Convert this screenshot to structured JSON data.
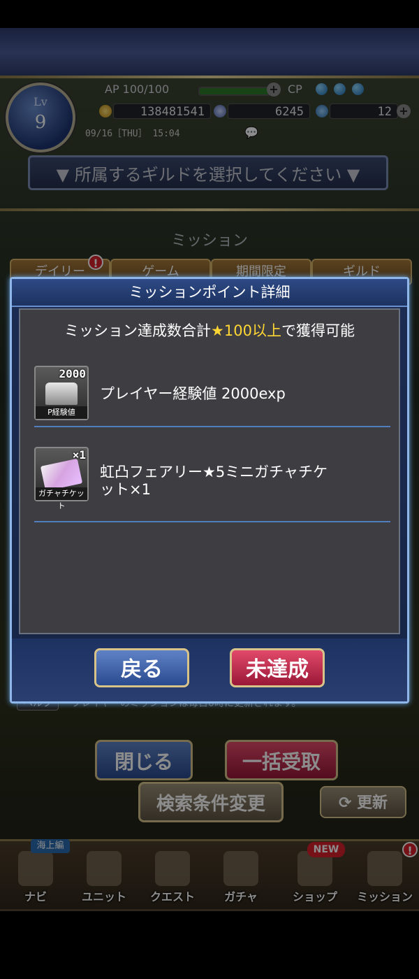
{
  "header": {
    "level_label": "Lv",
    "level_value": "9",
    "ap_text": "AP 100/100",
    "cp_label": "CP",
    "gold": "138481541",
    "gems": "6245",
    "tickets": "12",
    "datetime": "09/16［THU］ 15:04"
  },
  "guild_select": {
    "label": "▼ 所属するギルドを選択してください ▼"
  },
  "mission_screen": {
    "title": "ミッション",
    "tabs": [
      "デイリー",
      "ゲーム",
      "期間限定",
      "ギルド"
    ],
    "note": "プレイヤーのミッションは毎日0時に更新されます。",
    "help_label": "ヘルプ",
    "close_label": "閉じる",
    "claim_all_label": "一括受取",
    "search_label": "検索条件変更",
    "refresh_label": "更新"
  },
  "dialog": {
    "title": "ミッションポイント詳細",
    "condition_prefix": "ミッション達成数合計",
    "condition_highlight": "★100以上",
    "condition_suffix": "で獲得可能",
    "rewards": [
      {
        "count": "2000",
        "caption": "P経験値",
        "text": "プレイヤー経験値 2000exp"
      },
      {
        "count": "×1",
        "caption": "ガチャチケット",
        "text": "虹凸フェアリー★5ミニガチャチケット×1"
      }
    ],
    "back_label": "戻る",
    "status_label": "未達成"
  },
  "nav": {
    "items": [
      "ナビ",
      "ユニット",
      "クエスト",
      "ガチャ",
      "ショップ",
      "ミッション"
    ],
    "badge_sea": "海上編",
    "badge_new": "NEW"
  },
  "colors": {
    "accent_yellow": "#ffd633",
    "dialog_border": "#8fb6e8"
  }
}
